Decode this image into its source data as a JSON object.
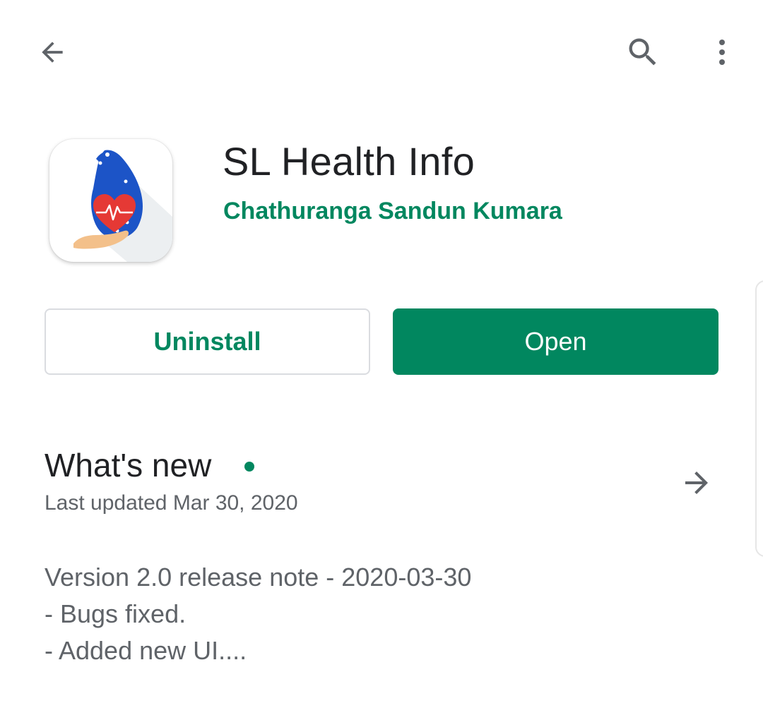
{
  "toolbar": {
    "back_icon": "arrow-back-icon",
    "search_icon": "search-icon",
    "menu_icon": "more-vert-icon"
  },
  "app": {
    "icon": "sl-health-info-app-icon",
    "title": "SL Health Info",
    "developer": "Chathuranga Sandun Kumara"
  },
  "actions": {
    "uninstall_label": "Uninstall",
    "open_label": "Open"
  },
  "whats_new": {
    "title": "What's new",
    "last_updated": "Last updated Mar 30, 2020",
    "arrow_icon": "arrow-forward-icon",
    "notes": [
      "Version 2.0 release note - 2020-03-30",
      "- Bugs fixed.",
      "- Added new UI...."
    ]
  },
  "colors": {
    "accent": "#01875f",
    "text_primary": "#202124",
    "text_secondary": "#5f6368",
    "border": "#dadce0"
  }
}
